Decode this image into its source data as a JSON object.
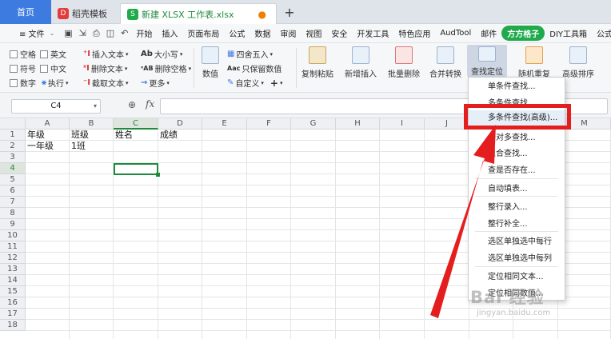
{
  "tabs": {
    "home": "首页",
    "template": "稻壳模板",
    "file": "新建 XLSX 工作表.xlsx",
    "template_icon": "D",
    "file_icon": "S"
  },
  "menubar": {
    "file_label": "≡ 文件",
    "items": [
      "开始",
      "插入",
      "页面布局",
      "公式",
      "数据",
      "审阅",
      "视图",
      "安全",
      "开发工具",
      "特色应用",
      "AudTool",
      "邮件",
      "方方格子",
      "DIY工具箱",
      "公式向"
    ]
  },
  "ribbon": {
    "checks": [
      "空格",
      "英文",
      "符号",
      "中文",
      "数字"
    ],
    "exec_label": "执行",
    "text_ops": [
      "插入文本",
      "删除文本",
      "截取文本"
    ],
    "case_ops": [
      "大小写",
      "删除空格",
      "更多"
    ],
    "numeric": "数值",
    "round": "四舍五入",
    "keep_values": "只保留数值",
    "custom": "自定义",
    "plus": "+",
    "copy_paste": "复制粘贴",
    "new_insert": "新增插入",
    "batch_delete": "批量删除",
    "merge_convert": "合并转换",
    "find_locate": "查找定位",
    "random_repeat": "随机重复",
    "adv_sort": "高级排序"
  },
  "formula_bar": {
    "cell_ref": "C4",
    "fx": "fx",
    "value": ""
  },
  "grid": {
    "columns": [
      "A",
      "B",
      "C",
      "D",
      "E",
      "F",
      "G",
      "H",
      "I",
      "J",
      "K",
      "L",
      "M"
    ],
    "rows": [
      "1",
      "2",
      "3",
      "4",
      "5",
      "6",
      "7",
      "8",
      "9",
      "10",
      "11",
      "12",
      "13",
      "14",
      "15",
      "16",
      "17",
      "18"
    ],
    "cells": {
      "A1": "年级",
      "B1": "班级",
      "C1": "姓名",
      "D1": "成绩",
      "A2": "一年级",
      "B2": "1班"
    },
    "selected_cell": "C4"
  },
  "dropdown": {
    "items": [
      "单条件查找...",
      "多条件查找...",
      "多条件查找(高级)...",
      "一对多查找...",
      "组合查找...",
      "查是否存在...",
      "自动填表...",
      "整行录入...",
      "整行补全...",
      "选区单独选中每行",
      "选区单独选中每列",
      "定位相同文本...",
      "定位相同数值..."
    ],
    "highlighted": "多条件查找(高级)..."
  },
  "watermark": {
    "logo": "Bai 经验",
    "url": "jingyan.baidu.com"
  },
  "colors": {
    "accent_green": "#1f8a3c",
    "tab_blue": "#3d7be0",
    "annotation_red": "#e41e1e"
  }
}
